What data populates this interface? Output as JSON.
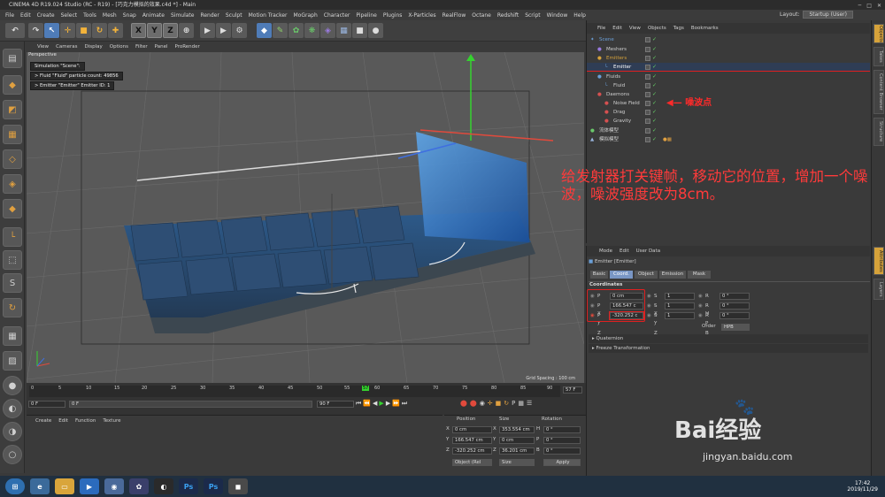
{
  "window": {
    "title": "CINEMA 4D R19.024 Studio (RC - R19) - [巧克力模拟的效果.c4d *] - Main"
  },
  "menubar": {
    "items": [
      "File",
      "Edit",
      "Create",
      "Select",
      "Tools",
      "Mesh",
      "Snap",
      "Animate",
      "Simulate",
      "Render",
      "Sculpt",
      "Motion Tracker",
      "MoGraph",
      "Character",
      "Pipeline",
      "Plugins",
      "X-Particles",
      "RealFlow",
      "Octane",
      "Redshift",
      "Script",
      "Window",
      "Help"
    ],
    "layout_label": "Layout:",
    "layout_value": "Startup (User)"
  },
  "toolbar": {
    "x": "X",
    "y": "Y",
    "z": "Z"
  },
  "viewport": {
    "menu": [
      "View",
      "Cameras",
      "Display",
      "Options",
      "Filter",
      "Panel",
      "ProRender"
    ],
    "label": "Perspective",
    "hud": [
      "Simulation \"Scene\":",
      "> Fluid \"Fluid\" particle count: 49856",
      "> Emitter \"Emitter\" Emitter ID: 1"
    ],
    "grid_spacing": "Grid Spacing : 100 cm"
  },
  "timeline": {
    "ticks": [
      "0",
      "5",
      "10",
      "15",
      "20",
      "25",
      "30",
      "35",
      "40",
      "45",
      "50",
      "55",
      "57",
      "60",
      "65",
      "70",
      "75",
      "80",
      "85",
      "90"
    ],
    "current_frame": "57 F",
    "start_field": "0 F",
    "min_field": "0 F",
    "max_field": "90 F",
    "end_field": "90 F"
  },
  "object_manager": {
    "menu": [
      "File",
      "Edit",
      "View",
      "Objects",
      "Tags",
      "Bookmarks"
    ],
    "objects": [
      {
        "name": "Scene",
        "color": "#6a9fd8"
      },
      {
        "name": "Meshers",
        "color": "#cfcfcf"
      },
      {
        "name": "Emitters",
        "color": "#d6a23a"
      },
      {
        "name": "Emitter",
        "color": "#e0e0e0"
      },
      {
        "name": "Fluids",
        "color": "#cfcfcf"
      },
      {
        "name": "Fluid",
        "color": "#cfcfcf"
      },
      {
        "name": "Daemons",
        "color": "#cfcfcf"
      },
      {
        "name": "Noise Field",
        "color": "#cfcfcf"
      },
      {
        "name": "Drag",
        "color": "#cfcfcf"
      },
      {
        "name": "Gravity",
        "color": "#cfcfcf"
      },
      {
        "name": "流体模型",
        "color": "#cfcfcf"
      },
      {
        "name": "模拟模型",
        "color": "#cfcfcf"
      }
    ],
    "annotation": "噪波点"
  },
  "attribute_manager": {
    "menu": [
      "Mode",
      "Edit",
      "User Data"
    ],
    "object_title": "Emitter [Emitter]",
    "tabs": [
      "Basic",
      "Coord.",
      "Object",
      "Emission",
      "Mask"
    ],
    "section": "Coordinates",
    "coords": [
      {
        "p_axis": "P . X",
        "p_val": "0 cm",
        "s_axis": "S . X",
        "s_val": "1",
        "r_axis": "R . H",
        "r_val": "0 °"
      },
      {
        "p_axis": "P . Y",
        "p_val": "166.547 c",
        "s_axis": "S . Y",
        "s_val": "1",
        "r_axis": "R . P",
        "r_val": "0 °"
      },
      {
        "p_axis": "P . Z",
        "p_val": "-320.252 c",
        "s_axis": "S . Z",
        "s_val": "1",
        "r_axis": "R . B",
        "r_val": "0 °"
      }
    ],
    "order_label": "Order",
    "order_value": "HPB",
    "quaternion": "Quaternion",
    "freeze": "Freeze Transformation"
  },
  "right_tabs": [
    "Objects",
    "Takes",
    "Content Browser",
    "Structure",
    "Attributes",
    "Layers"
  ],
  "material_manager": {
    "menu": [
      "Create",
      "Edit",
      "Function",
      "Texture"
    ]
  },
  "coord_manager": {
    "headers": [
      "Position",
      "Size",
      "Rotation"
    ],
    "rows": [
      {
        "axis": "X",
        "pos": "0 cm",
        "size_axis": "X",
        "size": "353.554 cm",
        "rot_axis": "H",
        "rot": "0 °"
      },
      {
        "axis": "Y",
        "pos": "166.547 cm",
        "size_axis": "Y",
        "size": "0 cm",
        "rot_axis": "P",
        "rot": "0 °"
      },
      {
        "axis": "Z",
        "pos": "-320.252 cm",
        "size_axis": "Z",
        "size": "36.201 cm",
        "rot_axis": "B",
        "rot": "0 °"
      }
    ],
    "mode": "Object (Rel",
    "size_mode": "Size",
    "apply": "Apply"
  },
  "annotation_text": "给发射器打关键帧，移动它的位置，增加一个噪波，噪波强度改为8cm。",
  "taskbar": {
    "time": "17:42",
    "date": "2019/11/29"
  },
  "watermark": {
    "brand": "Bai经验",
    "url": "jingyan.baidu.com"
  }
}
